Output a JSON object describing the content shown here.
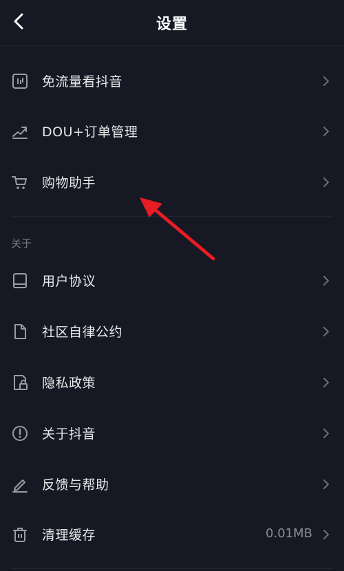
{
  "header": {
    "title": "设置"
  },
  "rows": [
    {
      "label": "免流量看抖音",
      "icon": "traffic-card-icon"
    },
    {
      "label": "DOU+订单管理",
      "icon": "trend-up-icon"
    },
    {
      "label": "购物助手",
      "icon": "shopping-cart-icon"
    }
  ],
  "about_section": {
    "title": "关于",
    "rows": [
      {
        "label": "用户协议",
        "icon": "book-icon"
      },
      {
        "label": "社区自律公约",
        "icon": "document-icon"
      },
      {
        "label": "隐私政策",
        "icon": "lock-document-icon"
      },
      {
        "label": "关于抖音",
        "icon": "info-icon"
      },
      {
        "label": "反馈与帮助",
        "icon": "pencil-icon"
      },
      {
        "label": "清理缓存",
        "icon": "trash-icon",
        "value": "0.01MB"
      }
    ]
  },
  "colors": {
    "background": "#161823",
    "annotation_arrow": "#e81c24"
  }
}
